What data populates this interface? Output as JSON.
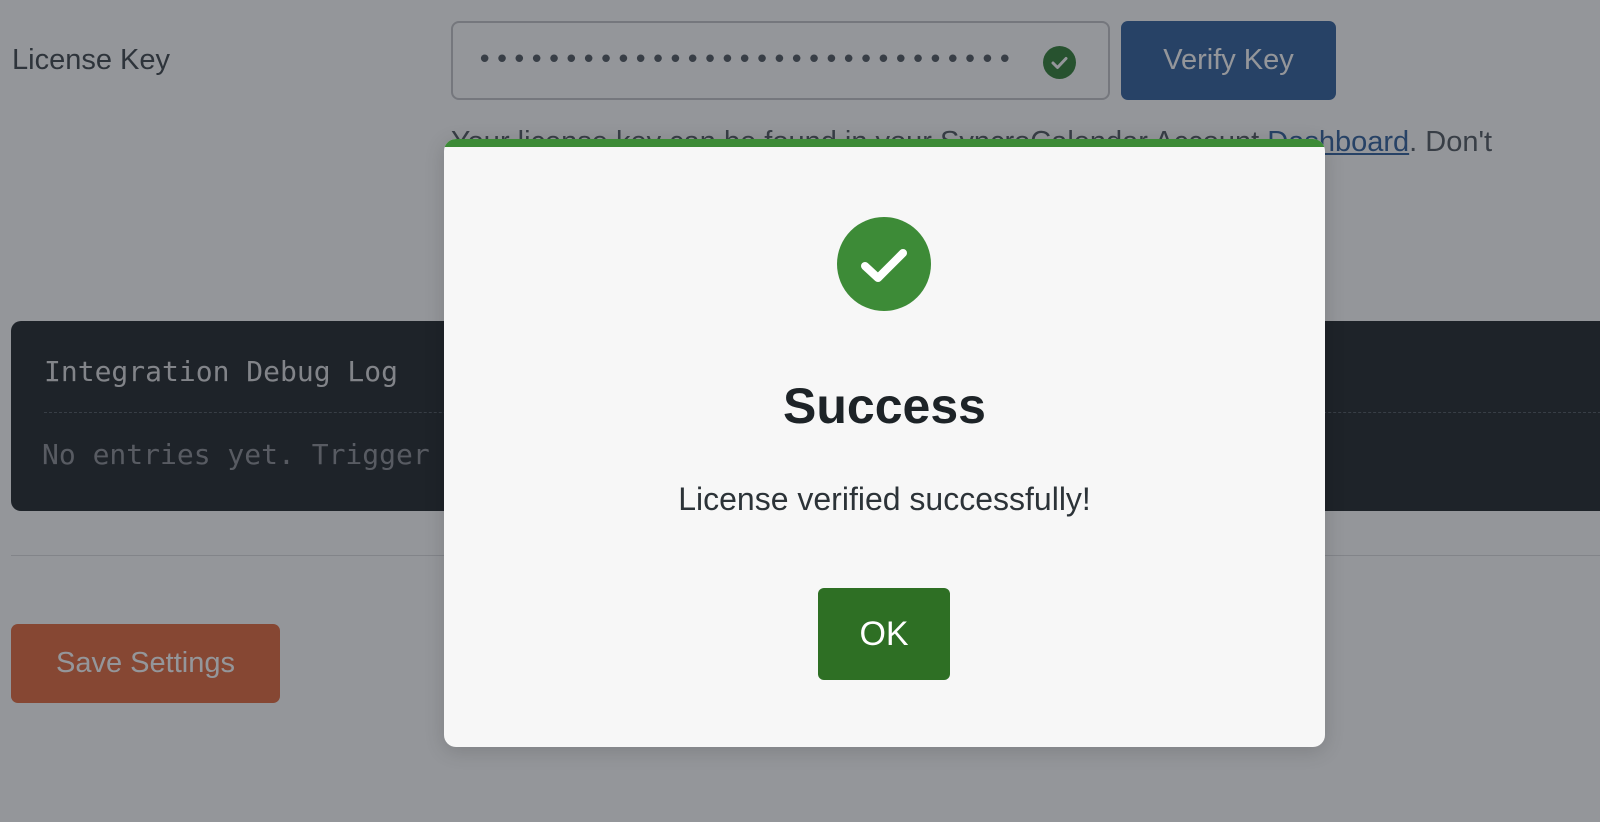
{
  "settings": {
    "license_label": "License Key",
    "license_value_masked": "•••••••••••••••••••••••••••••••",
    "verify_button": "Verify Key",
    "helper_text_start": "Your license key can be found in your SyncroCalendar Account ",
    "helper_link": "Dashboard",
    "helper_text_end": ". Don't",
    "save_button": "Save Settings"
  },
  "debug_log": {
    "title": "Integration Debug Log",
    "empty_text": "No entries yet. Trigger"
  },
  "modal": {
    "title": "Success",
    "message": "License verified successfully!",
    "ok_button": "OK",
    "icon": "check-circle-icon",
    "accent_color": "#3d8b37"
  },
  "colors": {
    "primary": "#2f5f9b",
    "success": "#3d8b37",
    "ok_button": "#2e6f24",
    "save": "#e4683a"
  }
}
